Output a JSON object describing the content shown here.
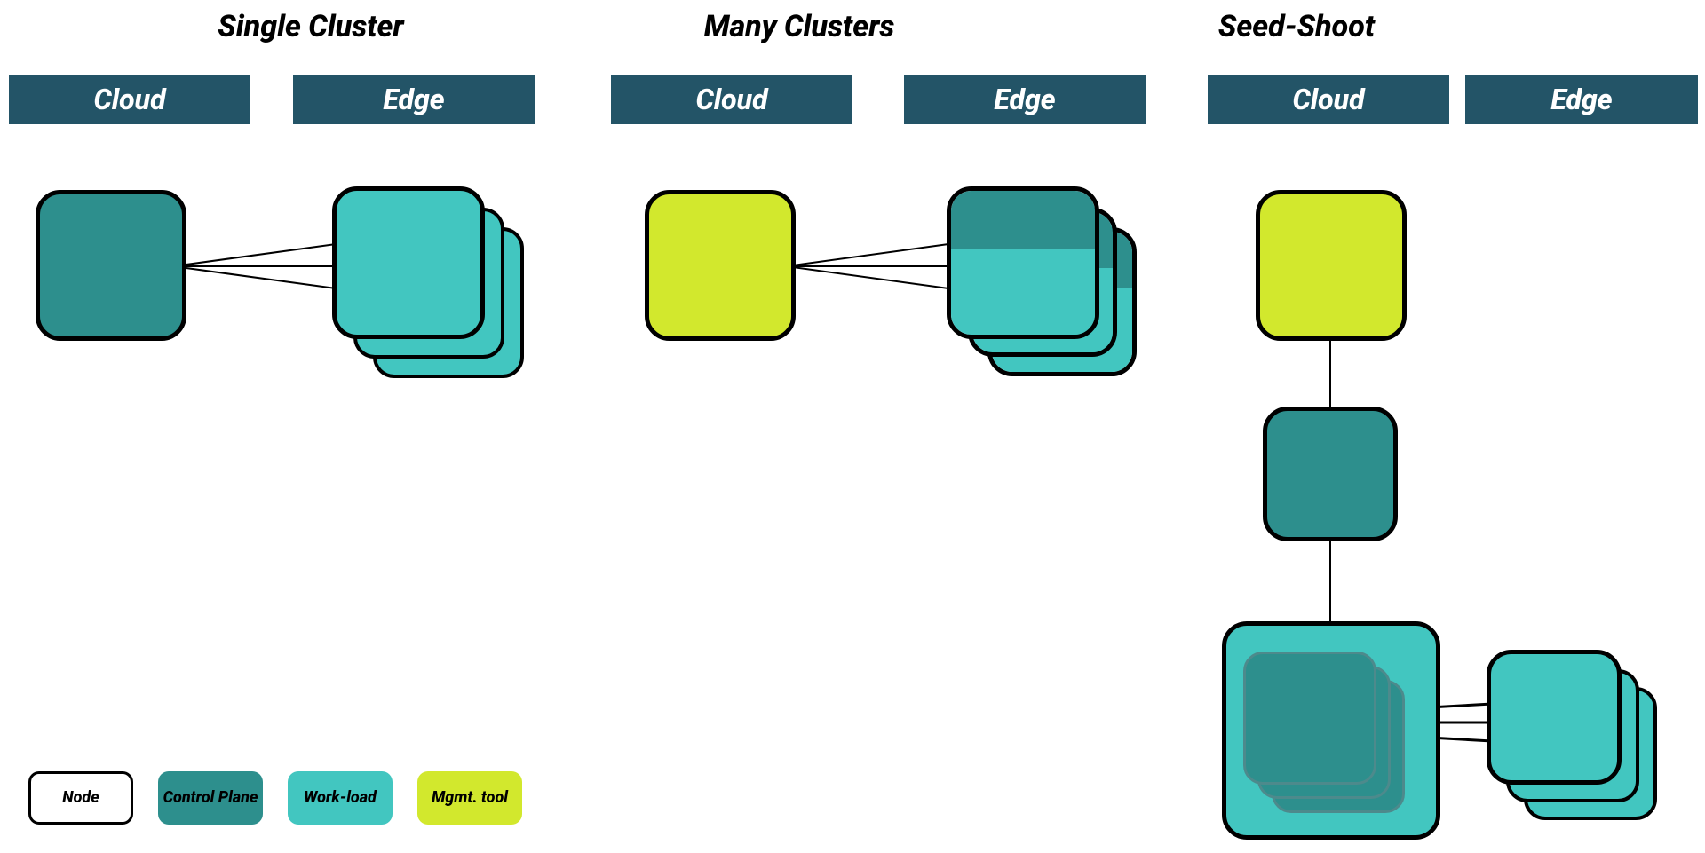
{
  "titles": {
    "single": "Single Cluster",
    "many": "Many Clusters",
    "seed": "Seed-Shoot"
  },
  "labels": {
    "cloud": "Cloud",
    "edge": "Edge"
  },
  "legend": {
    "node": "Node",
    "control": "Control Plane",
    "workload": "Work-load",
    "mgmt": "Mgmt. tool"
  },
  "colors": {
    "header": "#235467",
    "control": "#2d8f8d",
    "workload": "#42c6c0",
    "mgmt": "#d2e82d"
  }
}
